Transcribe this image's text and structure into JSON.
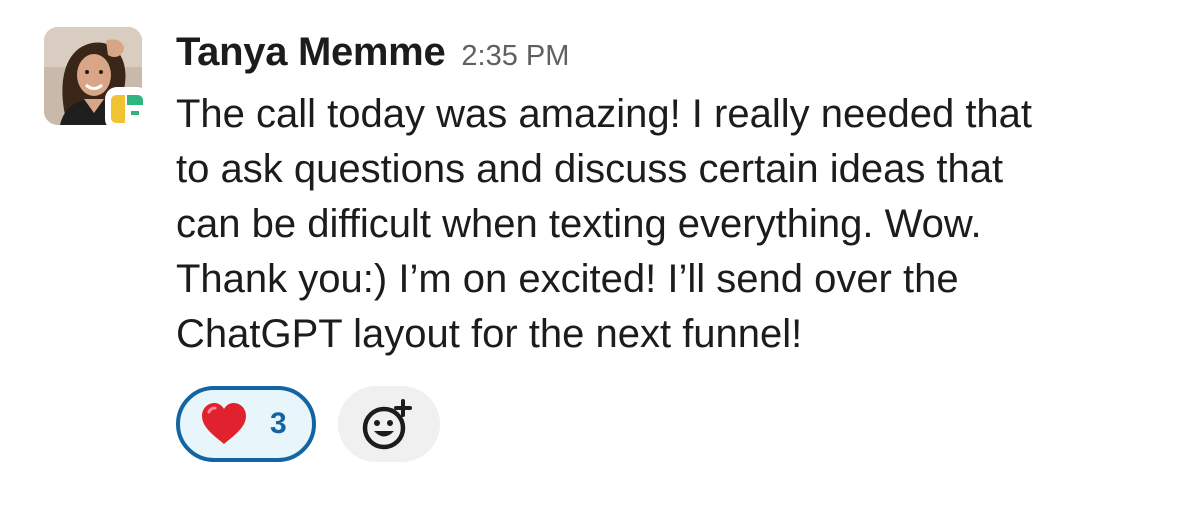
{
  "message": {
    "sender": "Tanya Memme",
    "timestamp": "2:35 PM",
    "text": "The call today was amazing! I really needed that\nto ask questions and discuss certain ideas that\ncan be difficult when texting everything.  Wow.\nThank you:)  I’m on excited! I’ll send over the\nChatGPT layout for the next funnel!",
    "avatar_icon": "user-photo",
    "app_badge_icon": "app-badge-icon"
  },
  "reactions": [
    {
      "emoji_icon": "heart-emoji-icon",
      "count": "3",
      "selected": true,
      "color": "#1264a3"
    }
  ],
  "add_reaction": {
    "icon": "add-reaction-icon"
  },
  "colors": {
    "text": "#1d1c1d",
    "timestamp": "#616061",
    "reaction_border": "#1264a3",
    "reaction_bg": "#e8f5fa",
    "add_reaction_bg": "#f0f0f0"
  }
}
